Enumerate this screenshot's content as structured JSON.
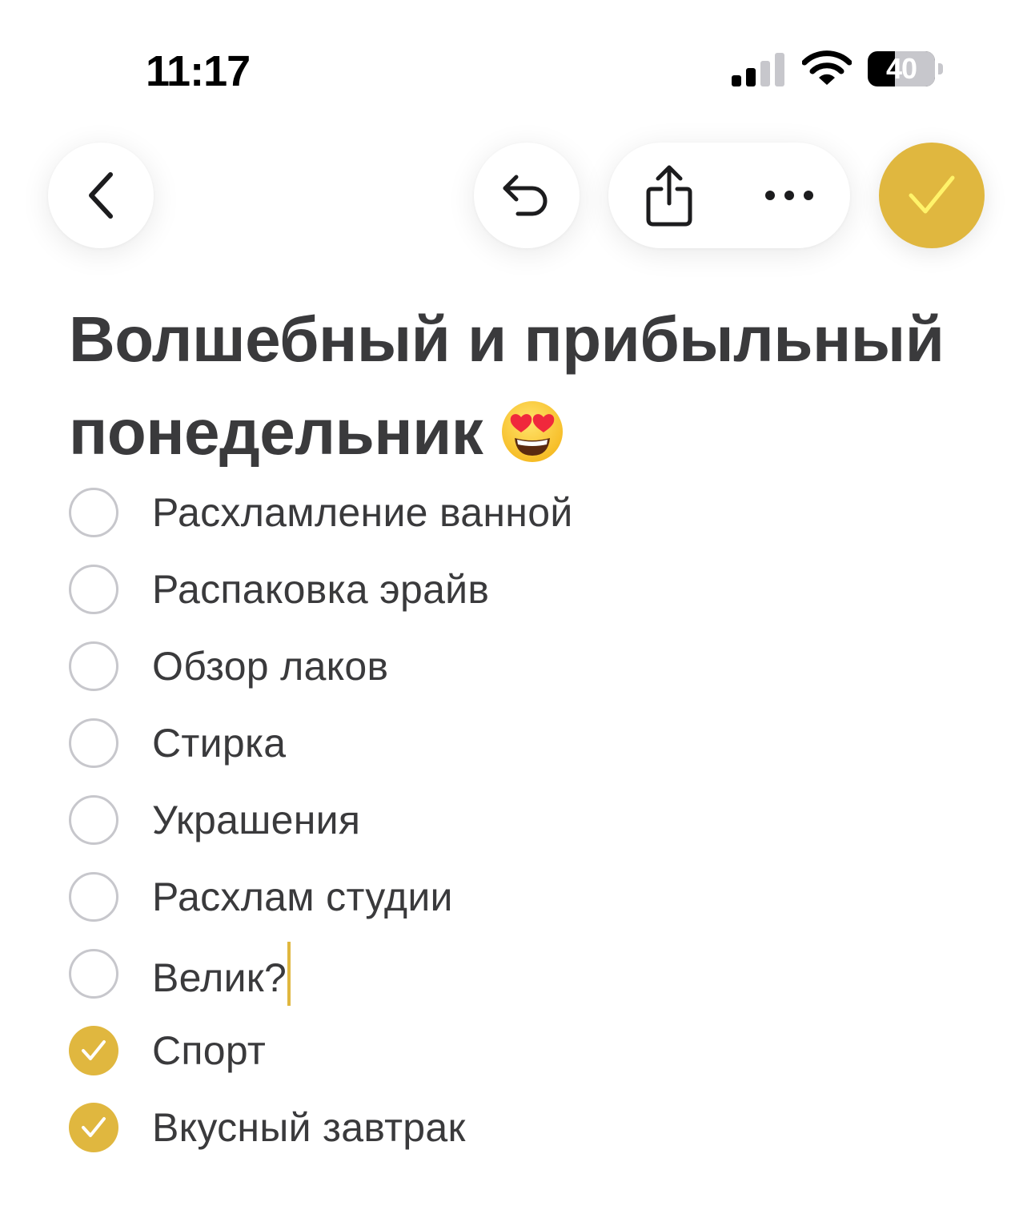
{
  "status_bar": {
    "time": "11:17",
    "battery_level": "40",
    "battery_fraction": 0.4,
    "signal_bars_active": 2,
    "signal_bars_total": 4
  },
  "toolbar": {
    "back_icon": "chevron-left-icon",
    "undo_icon": "undo-icon",
    "share_icon": "share-icon",
    "more_icon": "ellipsis-icon",
    "done_icon": "checkmark-icon"
  },
  "note": {
    "title": "Волшебный и прибыльный понедельник",
    "title_emoji": "heart-eyes-emoji",
    "items": [
      {
        "text": "Расхламление ванной",
        "checked": false
      },
      {
        "text": "Распаковка эрайв",
        "checked": false
      },
      {
        "text": "Обзор лаков",
        "checked": false
      },
      {
        "text": "Стирка",
        "checked": false
      },
      {
        "text": "Украшения",
        "checked": false
      },
      {
        "text": "Расхлам студии",
        "checked": false
      },
      {
        "text": "Велик?",
        "checked": false
      },
      {
        "text": "Спорт",
        "checked": true
      },
      {
        "text": "Вкусный завтрак",
        "checked": true
      }
    ]
  },
  "colors": {
    "accent": "#e0b73f",
    "done_check": "#fff36a",
    "text": "#3a3a3c",
    "unchecked_border": "#c7c7cc"
  }
}
